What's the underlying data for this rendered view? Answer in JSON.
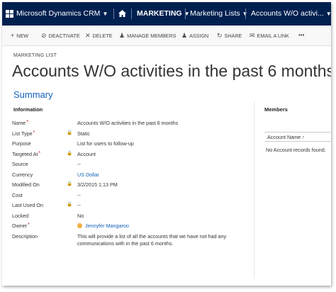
{
  "colors": {
    "navbar_bg": "#002050",
    "link": "#1160b7",
    "required": "#cc0000",
    "accent_title": "#1160b7"
  },
  "navbar": {
    "app_title": "Microsoft Dynamics CRM",
    "home_icon": "home-icon",
    "area": "MARKETING",
    "entity": "Marketing Lists",
    "record": "Accounts W/O activi..."
  },
  "commands": [
    {
      "icon": "plus-icon",
      "glyph": "+",
      "label": "NEW"
    },
    {
      "icon": "deactivate-icon",
      "glyph": "⊘",
      "label": "DEACTIVATE"
    },
    {
      "icon": "trash-icon",
      "glyph": "✕",
      "label": "DELETE"
    },
    {
      "icon": "manage-members-icon",
      "glyph": "♟",
      "label": "MANAGE MEMBERS"
    },
    {
      "icon": "assign-icon",
      "glyph": "♟",
      "label": "ASSIGN"
    },
    {
      "icon": "share-icon",
      "glyph": "↻",
      "label": "SHARE"
    },
    {
      "icon": "email-link-icon",
      "glyph": "✉",
      "label": "EMAIL A LINK"
    },
    {
      "icon": "more-icon",
      "glyph": "•••",
      "label": ""
    }
  ],
  "record": {
    "entity_label": "MARKETING LIST",
    "title": "Accounts W/O activities in the past 6 months"
  },
  "summary": {
    "heading": "Summary",
    "info_heading": "Information",
    "fields": [
      {
        "label": "Name",
        "required": "*",
        "locked": false,
        "value": "Accounts W/O activities in the past 6 months",
        "link": false
      },
      {
        "label": "List Type",
        "required": "*",
        "locked": true,
        "value": "Static",
        "link": false
      },
      {
        "label": "Purpose",
        "required": "",
        "locked": false,
        "value": "List for users to follow-up",
        "link": false
      },
      {
        "label": "Targeted At",
        "required": "*",
        "locked": true,
        "value": "Account",
        "link": false
      },
      {
        "label": "Source",
        "required": "",
        "locked": false,
        "value": "--",
        "link": false
      },
      {
        "label": "Currency",
        "required": "",
        "locked": false,
        "value": "US Dollar",
        "link": true
      },
      {
        "label": "Modified On",
        "required": "",
        "locked": true,
        "value": "3/2/2015   1:13 PM",
        "link": false
      },
      {
        "label": "Cost",
        "required": "",
        "locked": false,
        "value": "--",
        "link": false
      },
      {
        "label": "Last Used On",
        "required": "",
        "locked": true,
        "value": "--",
        "link": false
      },
      {
        "label": "Locked",
        "required": "",
        "locked": false,
        "value": "No",
        "link": false
      },
      {
        "label": "Owner",
        "required": "*",
        "locked": false,
        "value": "Jennyfer Mangaroo",
        "link": true,
        "user": true
      },
      {
        "label": "Description",
        "required": "",
        "locked": false,
        "value": "This will provide a list of all the accounts that we have not had any communications with in the past 6 months.",
        "link": false
      }
    ]
  },
  "members": {
    "heading": "Members",
    "column": "Account Name ↑",
    "empty": "No Account records found."
  }
}
